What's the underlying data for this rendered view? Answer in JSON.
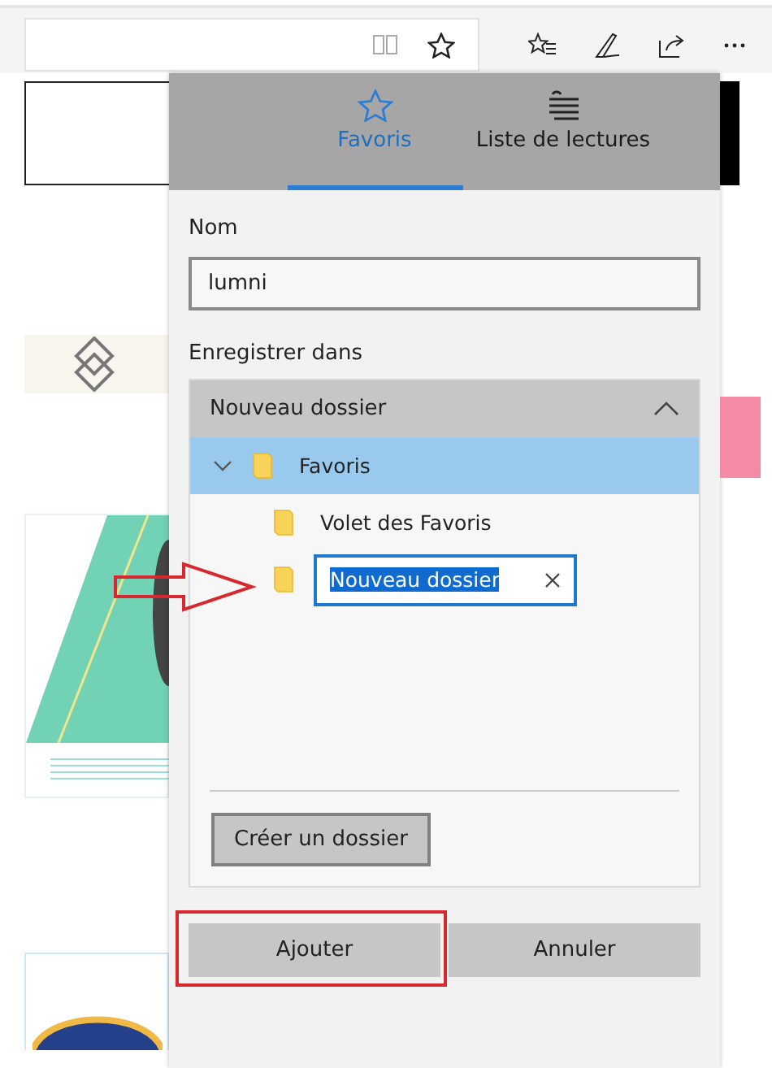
{
  "tabs": [
    {
      "label": "Favoris",
      "kind": "star",
      "selected": true
    },
    {
      "label": "Liste de lectures",
      "kind": "list",
      "selected": false
    }
  ],
  "name_field": {
    "label": "Nom",
    "value": "lumni"
  },
  "save_in": {
    "label": "Enregistrer dans",
    "dropdown": {
      "value": "Nouveau dossier",
      "expanded": true
    },
    "tree": [
      {
        "label": "Favoris",
        "selected": true,
        "expanded": true,
        "editing": false,
        "children": [
          {
            "label": "Volet des Favoris",
            "selected": false,
            "editing": false
          },
          {
            "label": "Nouveau dossier",
            "selected": false,
            "editing": true
          }
        ]
      }
    ]
  },
  "create_button": "Créer un dossier",
  "buttons": [
    {
      "label": "Ajouter",
      "highlighted": true
    },
    {
      "label": "Annuler",
      "highlighted": false
    }
  ]
}
